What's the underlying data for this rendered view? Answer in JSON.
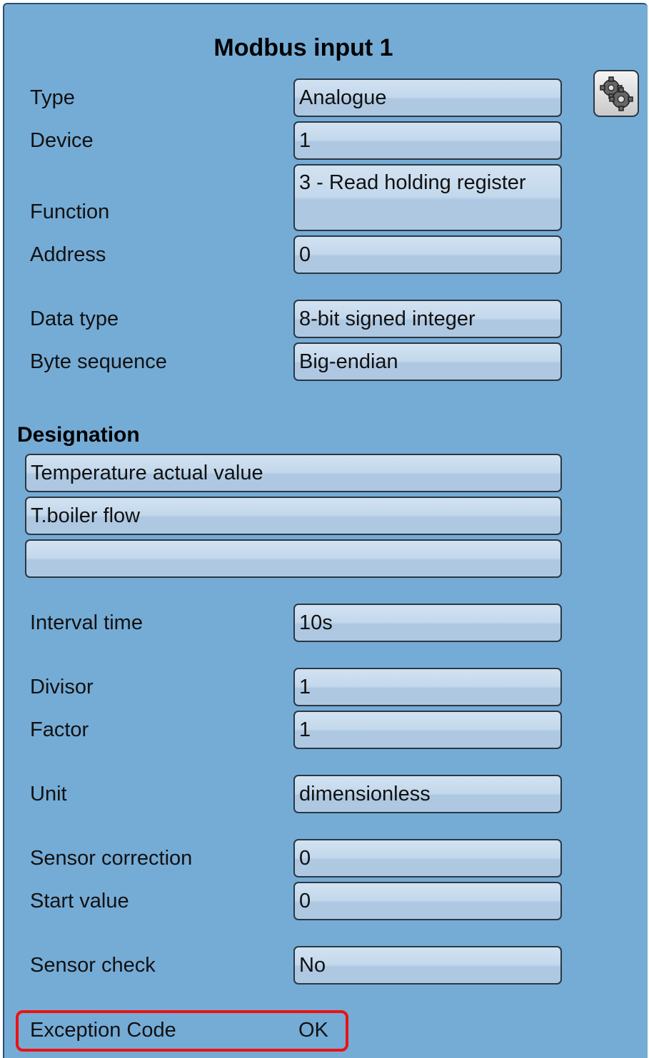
{
  "title": "Modbus input 1",
  "fields": {
    "type": {
      "label": "Type",
      "value": "Analogue"
    },
    "device": {
      "label": "Device",
      "value": "1"
    },
    "function": {
      "label": "Function",
      "value": "3 - Read holding register"
    },
    "address": {
      "label": "Address",
      "value": "0"
    },
    "data_type": {
      "label": "Data type",
      "value": "8-bit signed integer"
    },
    "byte_sequence": {
      "label": "Byte sequence",
      "value": "Big-endian"
    },
    "interval_time": {
      "label": "Interval time",
      "value": "10s"
    },
    "divisor": {
      "label": "Divisor",
      "value": "1"
    },
    "factor": {
      "label": "Factor",
      "value": "1"
    },
    "unit": {
      "label": "Unit",
      "value": "dimensionless"
    },
    "sensor_correction": {
      "label": "Sensor correction",
      "value": "0"
    },
    "start_value": {
      "label": "Start value",
      "value": "0"
    },
    "sensor_check": {
      "label": "Sensor check",
      "value": "No"
    }
  },
  "designation": {
    "heading": "Designation",
    "line1": "Temperature actual value",
    "line2": "T.boiler flow",
    "line3": ""
  },
  "exception": {
    "label": "Exception Code",
    "value": "OK"
  },
  "icons": {
    "settings": "gear-icon"
  },
  "colors": {
    "panel_bg": "#75acd6",
    "highlight_border": "#ee1111"
  }
}
